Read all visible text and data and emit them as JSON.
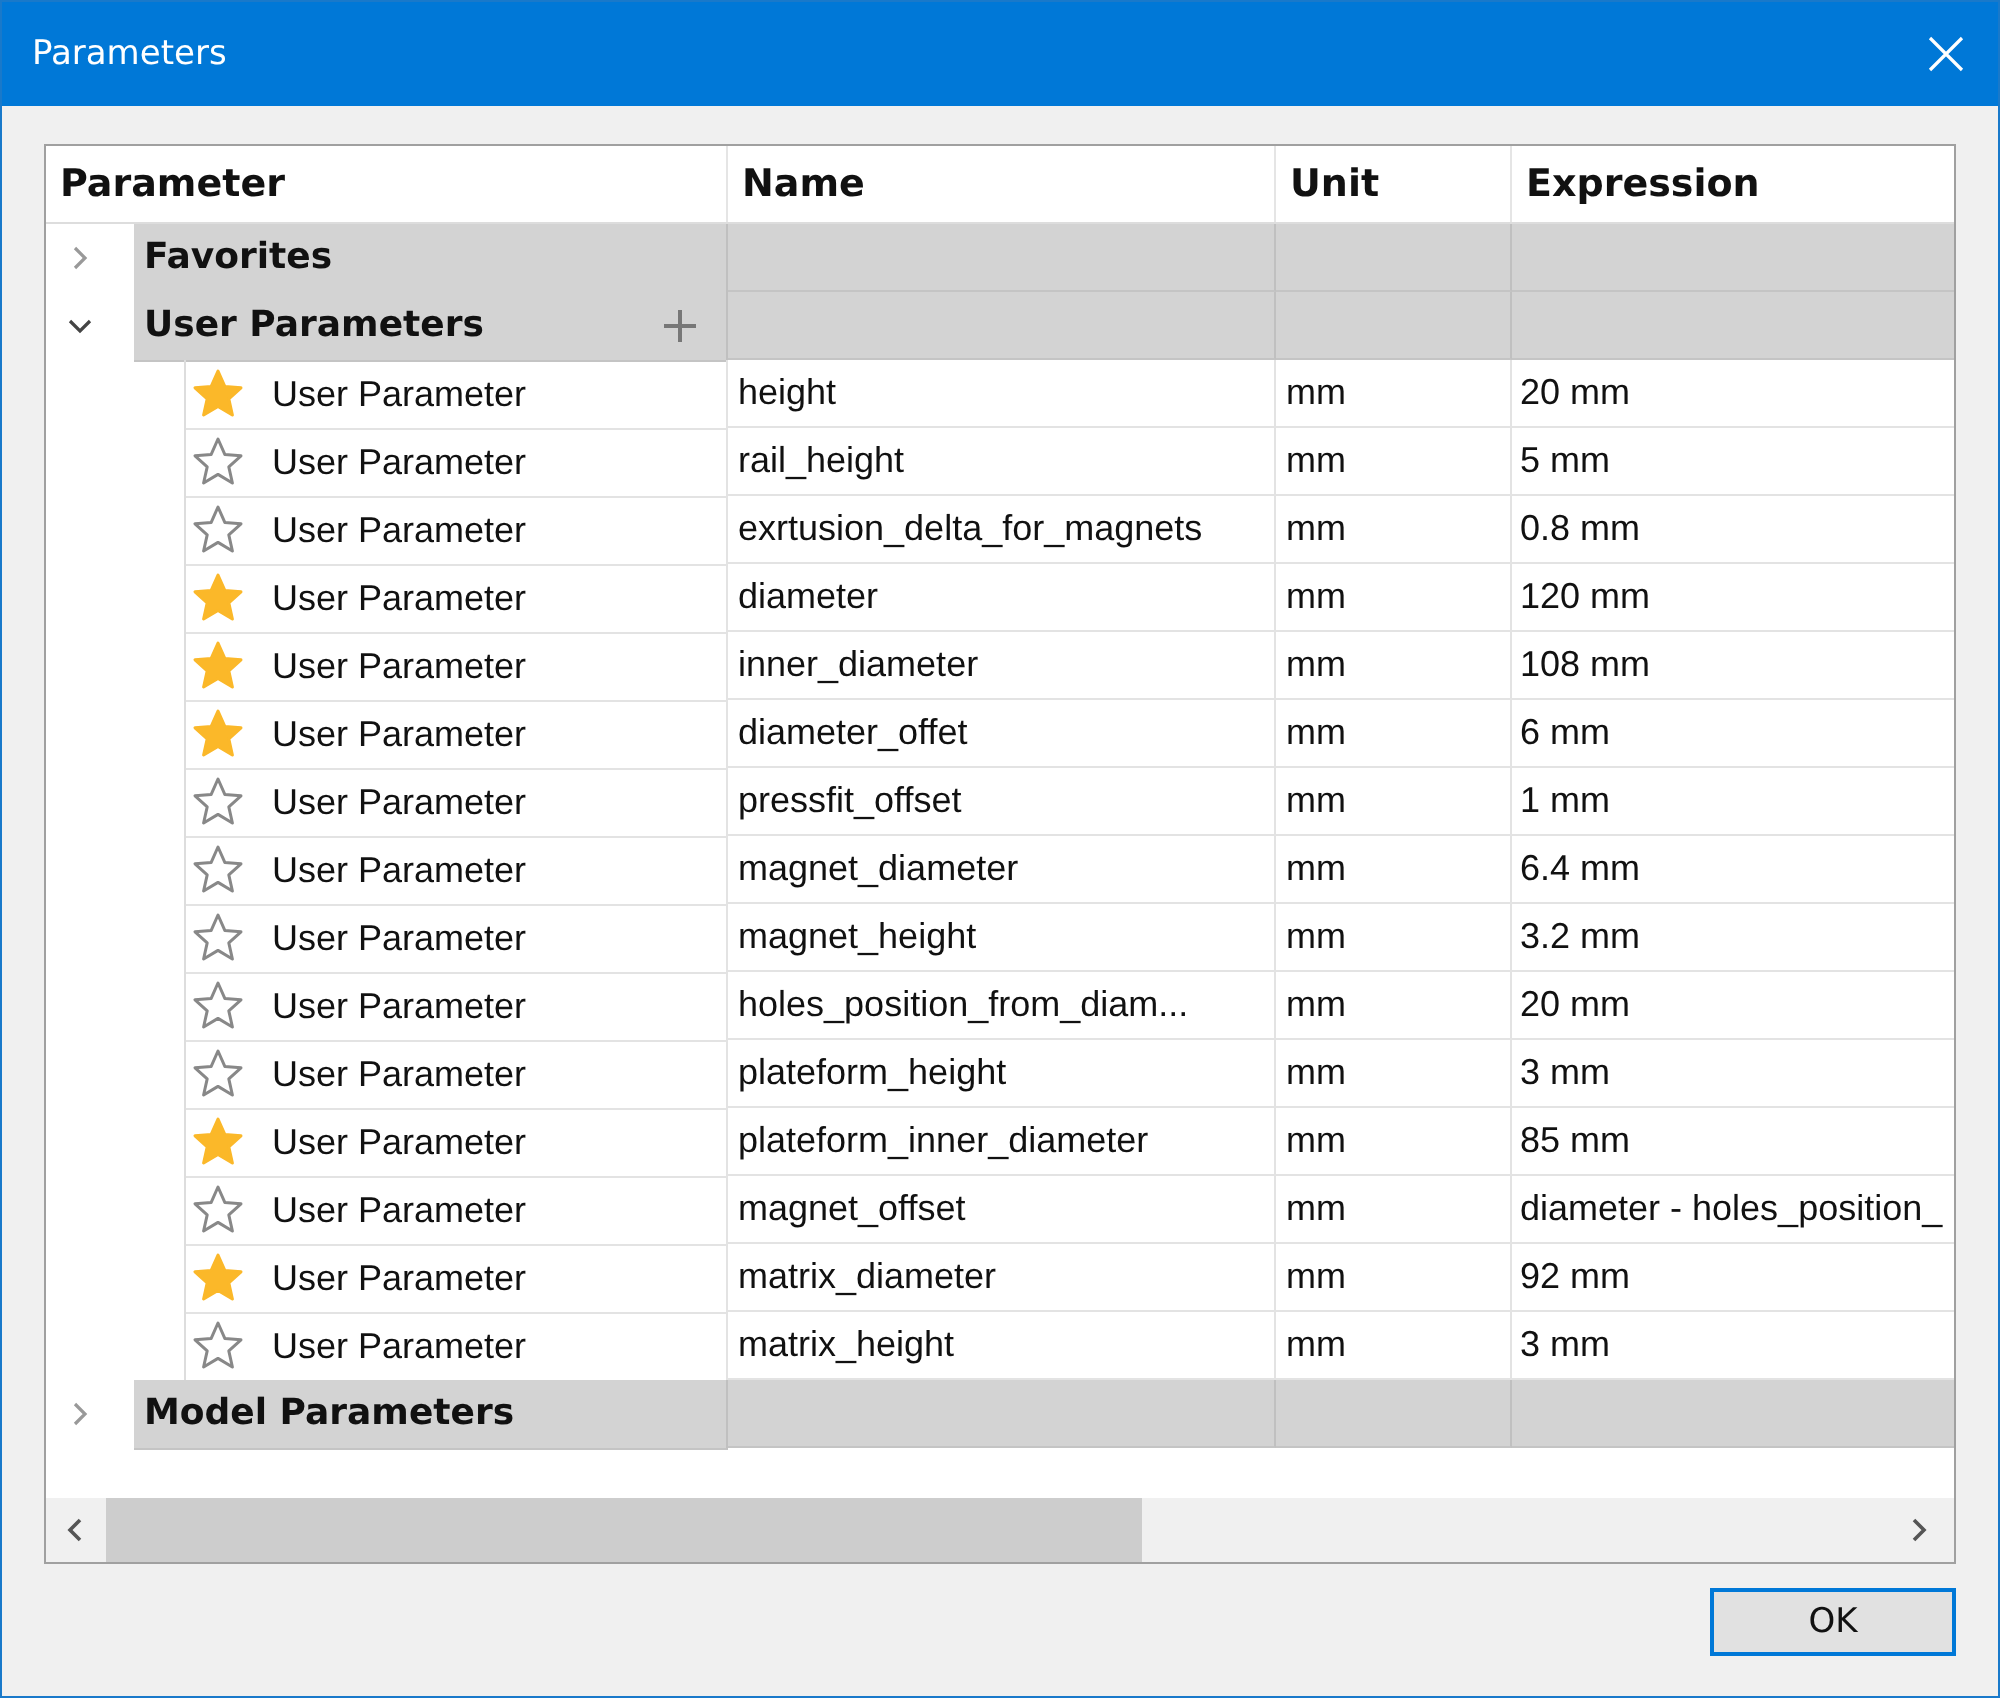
{
  "window": {
    "title": "Parameters"
  },
  "table": {
    "columns": [
      "Parameter",
      "Name",
      "Unit",
      "Expression"
    ],
    "groups": [
      {
        "label": "Favorites",
        "expanded": false
      },
      {
        "label": "User Parameters",
        "expanded": true,
        "rows": [
          {
            "favorite": true,
            "parameter": "User Parameter",
            "name": "height",
            "unit": "mm",
            "expression": "20 mm"
          },
          {
            "favorite": false,
            "parameter": "User Parameter",
            "name": "rail_height",
            "unit": "mm",
            "expression": "5 mm"
          },
          {
            "favorite": false,
            "parameter": "User Parameter",
            "name": "exrtusion_delta_for_magnets",
            "unit": "mm",
            "expression": "0.8 mm"
          },
          {
            "favorite": true,
            "parameter": "User Parameter",
            "name": "diameter",
            "unit": "mm",
            "expression": "120 mm"
          },
          {
            "favorite": true,
            "parameter": "User Parameter",
            "name": "inner_diameter",
            "unit": "mm",
            "expression": "108 mm"
          },
          {
            "favorite": true,
            "parameter": "User Parameter",
            "name": "diameter_offet",
            "unit": "mm",
            "expression": "6 mm"
          },
          {
            "favorite": false,
            "parameter": "User Parameter",
            "name": "pressfit_offset",
            "unit": "mm",
            "expression": "1 mm"
          },
          {
            "favorite": false,
            "parameter": "User Parameter",
            "name": "magnet_diameter",
            "unit": "mm",
            "expression": "6.4 mm"
          },
          {
            "favorite": false,
            "parameter": "User Parameter",
            "name": "magnet_height",
            "unit": "mm",
            "expression": "3.2 mm"
          },
          {
            "favorite": false,
            "parameter": "User Parameter",
            "name": "holes_position_from_diam...",
            "unit": "mm",
            "expression": "20 mm"
          },
          {
            "favorite": false,
            "parameter": "User Parameter",
            "name": "plateform_height",
            "unit": "mm",
            "expression": "3 mm"
          },
          {
            "favorite": true,
            "parameter": "User Parameter",
            "name": "plateform_inner_diameter",
            "unit": "mm",
            "expression": "85 mm"
          },
          {
            "favorite": false,
            "parameter": "User Parameter",
            "name": "magnet_offset",
            "unit": "mm",
            "expression": "diameter - holes_position_"
          },
          {
            "favorite": true,
            "parameter": "User Parameter",
            "name": "matrix_diameter",
            "unit": "mm",
            "expression": "92 mm"
          },
          {
            "favorite": false,
            "parameter": "User Parameter",
            "name": "matrix_height",
            "unit": "mm",
            "expression": "3 mm"
          }
        ]
      },
      {
        "label": "Model Parameters",
        "expanded": false
      }
    ]
  },
  "buttons": [
    "OK"
  ]
}
